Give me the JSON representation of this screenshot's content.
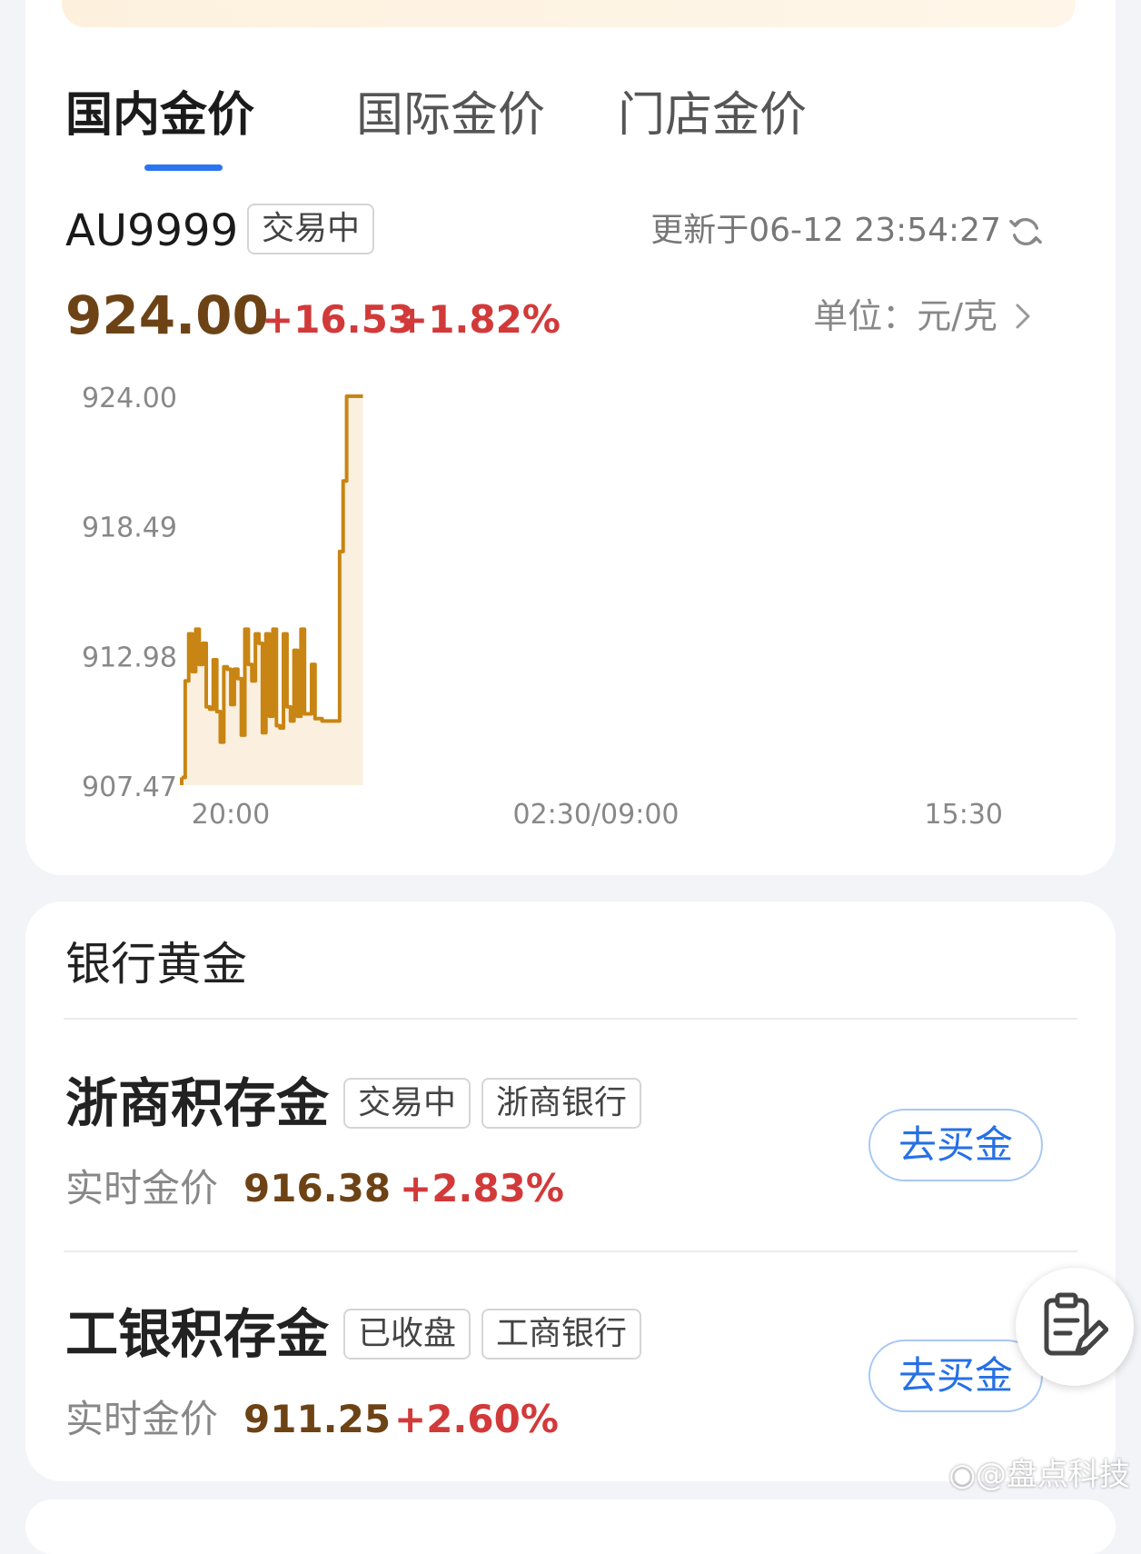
{
  "tabs": [
    {
      "label": "国内金价",
      "active": true
    },
    {
      "label": "国际金价",
      "active": false
    },
    {
      "label": "门店金价",
      "active": false
    }
  ],
  "quote": {
    "symbol": "AU9999",
    "status": "交易中",
    "updated": "更新于06-12 23:54:27",
    "price": "924.00",
    "change": "+16.53",
    "change_pct": "+1.82%",
    "unit": "单位：元/克"
  },
  "chart_data": {
    "type": "area",
    "y_ticks": [
      "924.00",
      "918.49",
      "912.98",
      "907.47"
    ],
    "x_ticks": [
      "20:00",
      "02:30/09:00",
      "15:30"
    ],
    "ylim": [
      907.47,
      924.0
    ],
    "x_session_start": "20:00",
    "x_session_end": "15:30",
    "x": [
      "20:00",
      "20:05",
      "20:10",
      "20:15",
      "20:20",
      "20:25",
      "20:30",
      "20:35",
      "20:40",
      "20:45",
      "20:50",
      "20:55",
      "21:00",
      "21:05",
      "21:10",
      "21:15",
      "21:20",
      "21:25",
      "21:30",
      "21:35",
      "21:40",
      "21:45",
      "21:50",
      "21:55",
      "22:00",
      "22:05",
      "22:10",
      "22:15",
      "22:20",
      "22:25",
      "22:30",
      "22:35",
      "22:40",
      "22:45",
      "22:50",
      "22:55",
      "23:00",
      "23:05",
      "23:10",
      "23:15",
      "23:20",
      "23:25",
      "23:30",
      "23:35",
      "23:40",
      "23:45",
      "23:50",
      "23:55"
    ],
    "y": [
      907.8,
      911.9,
      913.9,
      912.3,
      914.1,
      912.6,
      913.5,
      910.8,
      910.7,
      912.8,
      910.6,
      909.3,
      912.5,
      912.4,
      910.9,
      912.4,
      912.0,
      909.6,
      914.1,
      912.6,
      911.9,
      913.9,
      913.5,
      909.7,
      913.9,
      910.4,
      914.1,
      910.0,
      909.9,
      913.9,
      910.8,
      910.2,
      913.2,
      910.4,
      914.1,
      910.5,
      910.5,
      912.6,
      910.3,
      910.3,
      910.2,
      910.2,
      910.2,
      910.2,
      910.2,
      917.4,
      920.4,
      924.0
    ],
    "line_color": "#c88513",
    "fill_color": "#fbf0e0"
  },
  "bank": {
    "title": "银行黄金",
    "realtime_label": "实时金价",
    "buy_label": "去买金",
    "items": [
      {
        "name": "浙商积存金",
        "status": "交易中",
        "bank": "浙商银行",
        "price": "916.38",
        "change_pct": "+2.83%"
      },
      {
        "name": "工银积存金",
        "status": "已收盘",
        "bank": "工商银行",
        "price": "911.25",
        "change_pct": "+2.60%"
      }
    ]
  },
  "watermark": "@盘点科技",
  "icons": {
    "refresh": "refresh-icon",
    "chevron": "chevron-right-icon",
    "float": "clipboard-edit-icon",
    "weibo": "weibo-icon"
  }
}
